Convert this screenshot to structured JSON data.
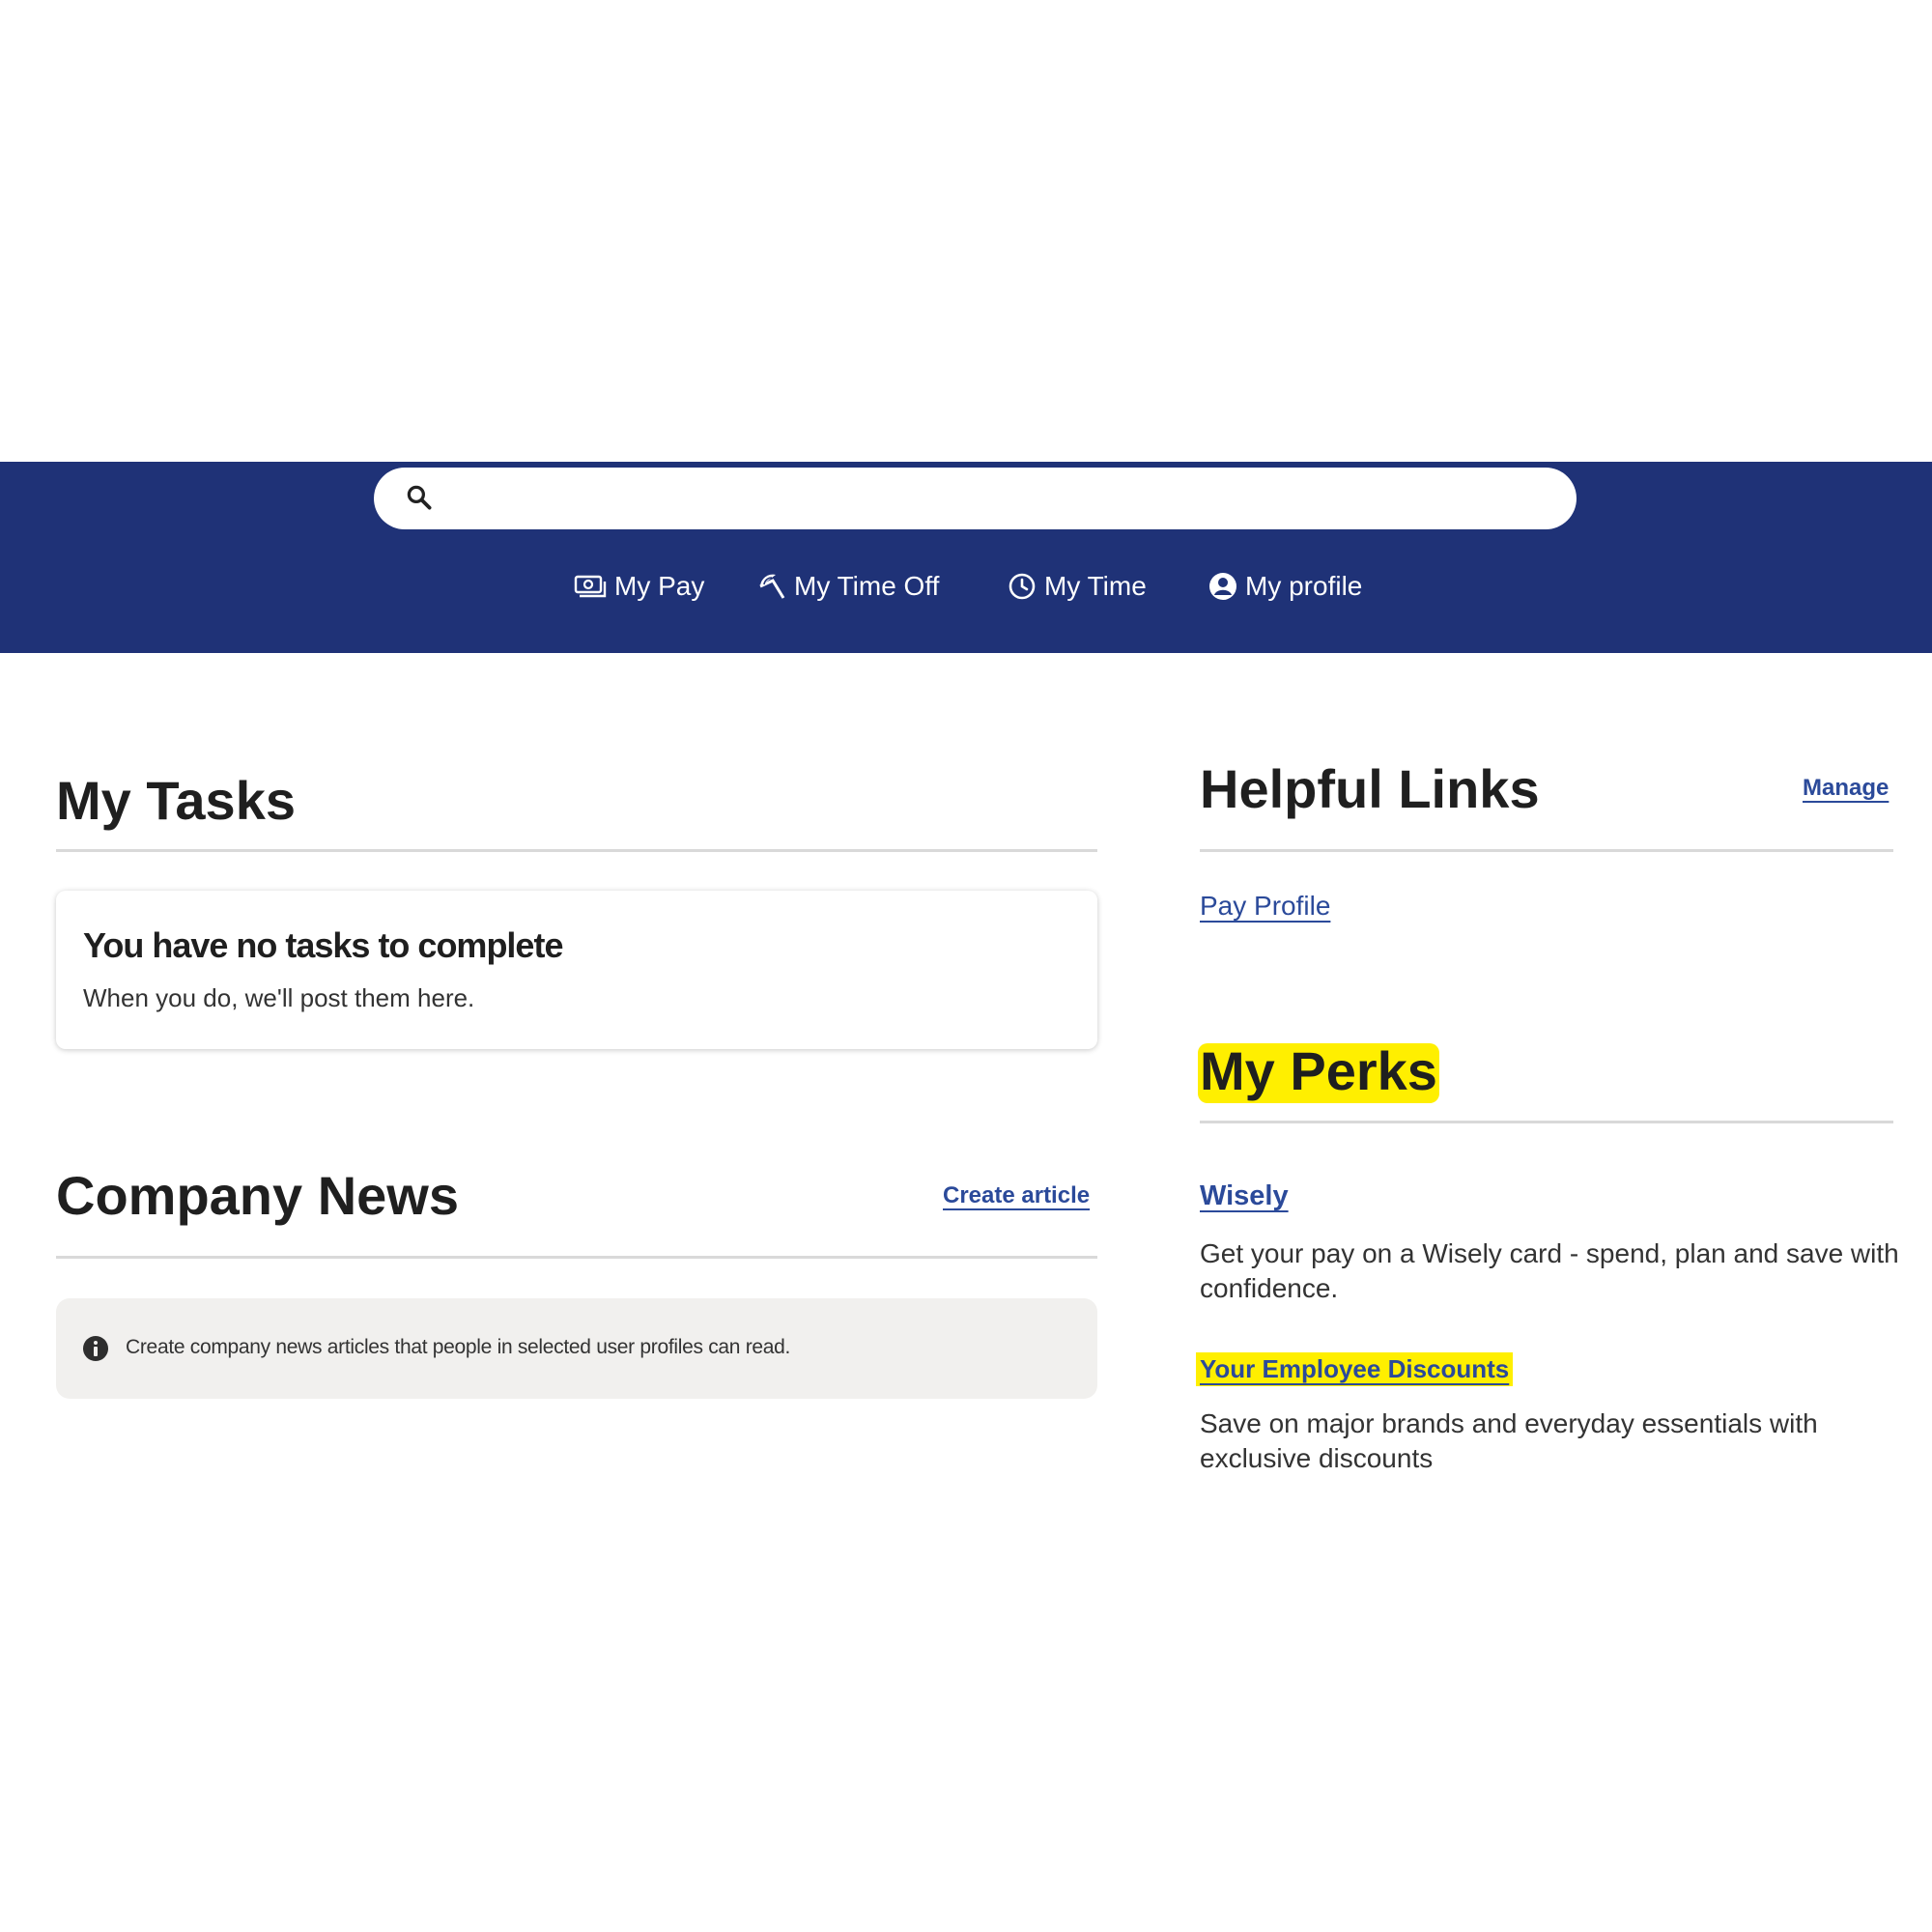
{
  "search": {
    "placeholder": "",
    "value": ""
  },
  "nav": {
    "my_pay": "My Pay",
    "my_time_off": "My Time Off",
    "my_time": "My Time",
    "my_profile": "My profile"
  },
  "my_tasks": {
    "title": "My Tasks",
    "empty_title": "You have no tasks to complete",
    "empty_subtitle": "When you do, we'll post them here."
  },
  "company_news": {
    "title": "Company News",
    "create_label": "Create article",
    "notice": "Create company news articles that people in selected user profiles can read."
  },
  "helpful_links": {
    "title": "Helpful Links",
    "manage_label": "Manage",
    "links": [
      "Pay Profile"
    ]
  },
  "my_perks": {
    "title": "My Perks",
    "items": [
      {
        "title": "Wisely",
        "description": "Get your pay on a Wisely card - spend, plan and save with confidence."
      },
      {
        "title": "Your Employee Discounts",
        "description": "Save on major brands and everyday essentials with exclusive discounts"
      }
    ]
  },
  "colors": {
    "header_bg": "#1f3277",
    "link": "#2b4a9a",
    "highlight": "#ffef00"
  },
  "icons": {
    "search": "search-icon",
    "my_pay": "money-icon",
    "my_time_off": "beach-umbrella-icon",
    "my_time": "clock-icon",
    "my_profile": "user-circle-icon",
    "notice": "info-icon"
  }
}
